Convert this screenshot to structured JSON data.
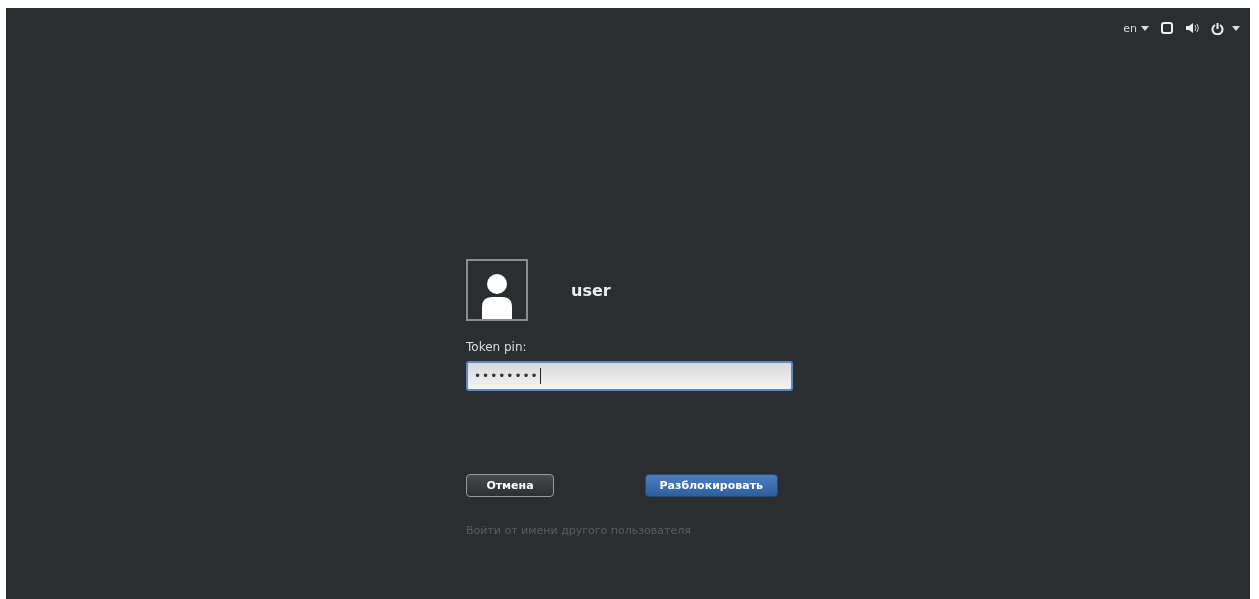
{
  "top_bar": {
    "language": "en"
  },
  "login": {
    "username": "user",
    "prompt": "Token pin:",
    "value": "••••••••",
    "focused": true
  },
  "buttons": [
    {
      "label": "Отмена",
      "kind": "secondary"
    },
    {
      "label": "Разблокировать",
      "kind": "primary"
    }
  ],
  "other_user_link": "Войти от имени другого пользователя"
}
